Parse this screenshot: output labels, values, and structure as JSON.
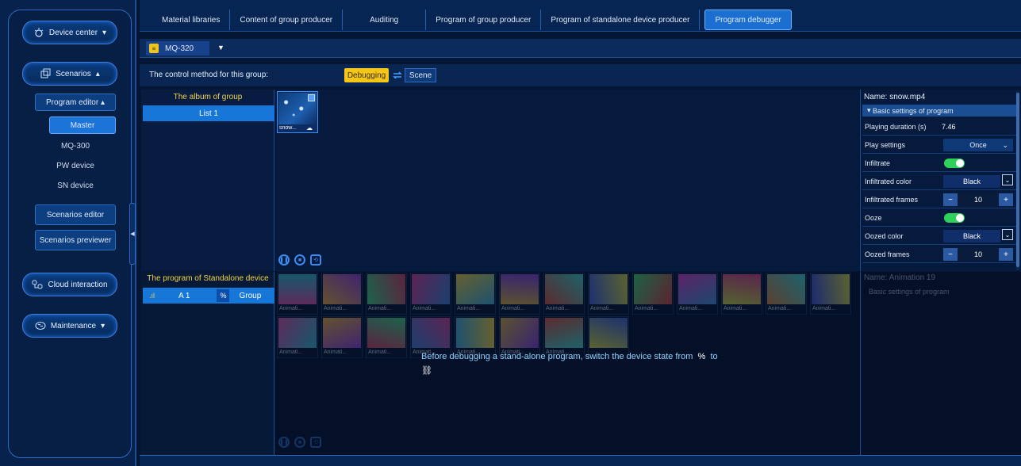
{
  "sidebar": {
    "device_center": "Device center",
    "scenarios": "Scenarios",
    "program_editor": "Program editor",
    "items": [
      "Master",
      "MQ-300",
      "PW device",
      "SN device"
    ],
    "scenarios_editor": "Scenarios editor",
    "scenarios_previewer": "Scenarios previewer",
    "cloud_interaction": "Cloud interaction",
    "maintenance": "Maintenance"
  },
  "tabs": [
    "Material libraries",
    "Content of group producer",
    "Auditing",
    "Program of group producer",
    "Program of standalone device producer",
    "Program debugger"
  ],
  "device": {
    "name": "MQ-320"
  },
  "control": {
    "label": "The control method for this group:",
    "debugging": "Debugging",
    "scene": "Scene"
  },
  "album": {
    "title": "The album of group",
    "list": "List 1",
    "thumb_caption": "snow..."
  },
  "props": {
    "name": "Name:  snow.mp4",
    "section": "Basic settings of program",
    "rows": {
      "playing_duration": {
        "label": "Playing duration (s)",
        "value": "7.46"
      },
      "play_settings": {
        "label": "Play settings",
        "value": "Once"
      },
      "infiltrate": {
        "label": "Infiltrate",
        "on": true
      },
      "infiltrated_color": {
        "label": "Infiltrated color",
        "value": "Black"
      },
      "infiltrated_frames": {
        "label": "Infiltrated frames",
        "value": "10"
      },
      "ooze": {
        "label": "Ooze",
        "on": true
      },
      "oozed_color": {
        "label": "Oozed color",
        "value": "Black"
      },
      "oozed_frames": {
        "label": "Oozed frames",
        "value": "10"
      }
    }
  },
  "standalone": {
    "title": "The program of Standalone device",
    "row_name": "A 1",
    "group": "Group",
    "anim_caption": "Animati...",
    "message": "Before debugging a stand-alone program, switch the device state from",
    "message_to": "to",
    "props_name": "Name:  Animation 19",
    "props_section": "Basic settings of program"
  },
  "colors": {
    "accent": "#1677d8",
    "highlight": "#f4c617",
    "toggle": "#2fd15a"
  }
}
